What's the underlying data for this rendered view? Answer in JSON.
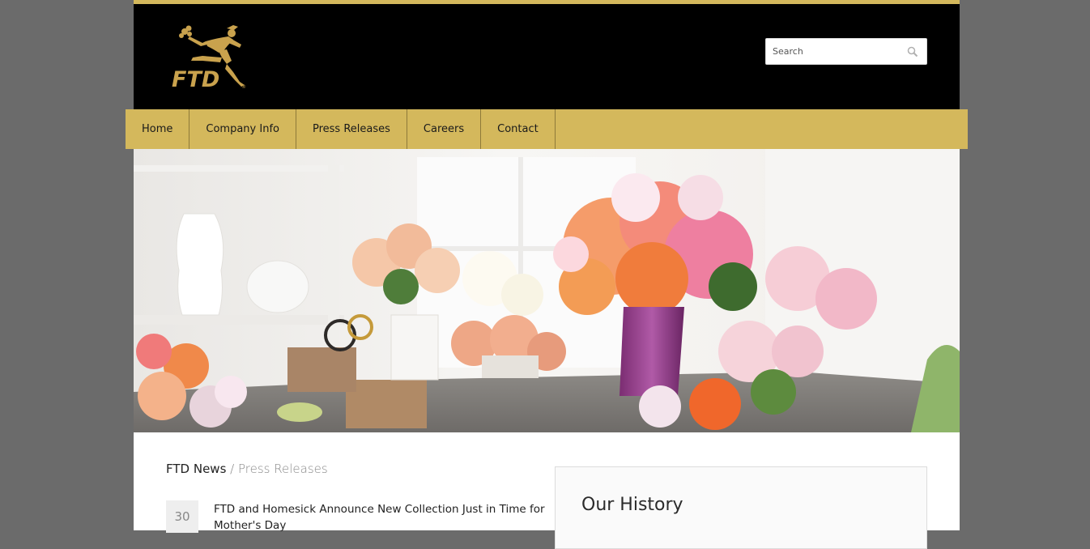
{
  "brand": {
    "logo_text": "FTD",
    "gold": "#d4b85c",
    "header_bg": "#000000"
  },
  "search": {
    "placeholder": "Search",
    "icon": "search-icon"
  },
  "nav": {
    "items": [
      {
        "label": "Home"
      },
      {
        "label": "Company Info"
      },
      {
        "label": "Press Releases"
      },
      {
        "label": "Careers"
      },
      {
        "label": "Contact"
      }
    ]
  },
  "hero": {
    "alt": "Flower arrangements on a table"
  },
  "breadcrumb": {
    "root": "FTD News",
    "separator": "/",
    "current": "Press Releases"
  },
  "news": {
    "items": [
      {
        "day": "30",
        "title": "FTD and Homesick Announce New Collection Just in Time for Mother's Day"
      }
    ]
  },
  "sidebar": {
    "history_title": "Our History"
  }
}
